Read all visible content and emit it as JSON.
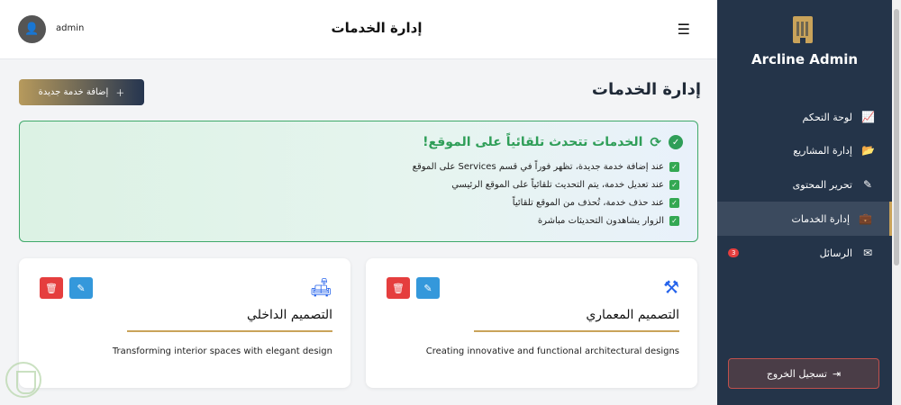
{
  "header": {
    "title": "إدارة الخدمات",
    "username": "admin"
  },
  "sidebar": {
    "brand": "Arcline Admin",
    "items": [
      {
        "label": "لوحة التحكم",
        "icon": "chart-line-icon"
      },
      {
        "label": "إدارة المشاريع",
        "icon": "folder-icon"
      },
      {
        "label": "تحرير المحتوى",
        "icon": "edit-icon"
      },
      {
        "label": "إدارة الخدمات",
        "icon": "briefcase-icon",
        "active": true
      },
      {
        "label": "الرسائل",
        "icon": "envelope-icon",
        "badge": "3"
      }
    ],
    "logout_label": "تسجيل الخروج"
  },
  "main": {
    "page_title": "إدارة الخدمات",
    "add_button_label": "إضافة خدمة جديدة",
    "alert": {
      "title": "الخدمات تتحدث تلقائياً على الموقع!",
      "items": [
        "عند إضافة خدمة جديدة، تظهر فوراً في قسم Services على الموقع",
        "عند تعديل خدمة، يتم التحديث تلقائياً على الموقع الرئيسي",
        "عند حذف خدمة، تُحذف من الموقع تلقائياً",
        "الزوار يشاهدون التحديثات مباشرة"
      ]
    },
    "cards": [
      {
        "title": "التصميم المعماري",
        "description": "Creating innovative and functional architectural designs",
        "icon": "drafting-compass-icon"
      },
      {
        "title": "التصميم الداخلي",
        "description": "Transforming interior spaces with elegant design",
        "icon": "sofa-icon"
      }
    ]
  },
  "colors": {
    "sidebar_bg": "#243449",
    "accent_gold": "#c9a35a",
    "success_green": "#2f9e58",
    "danger_red": "#e53e3e",
    "edit_blue": "#3498db"
  }
}
